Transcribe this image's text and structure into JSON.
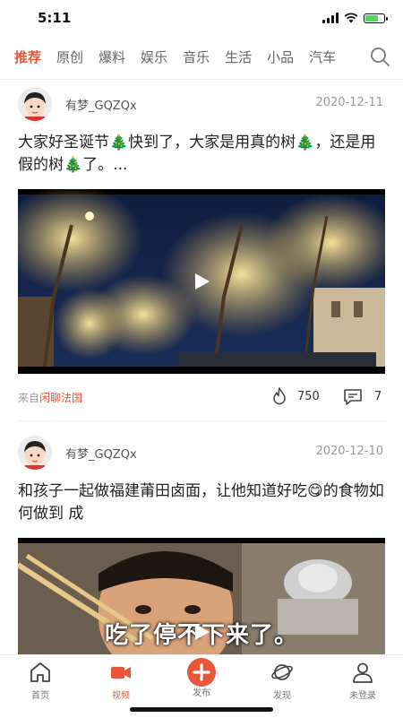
{
  "status_bar": {
    "time": "5:11"
  },
  "tabs": [
    "推荐",
    "原创",
    "爆料",
    "娱乐",
    "音乐",
    "生活",
    "小品",
    "汽车"
  ],
  "active_tab": 0,
  "posts": [
    {
      "username": "有梦_GQZQx",
      "date": "2020-12-11",
      "text_parts": [
        "大家好圣诞节",
        "🎄",
        "快到了，大家是用真的树",
        "🎄",
        "，还是用假的树",
        "🎄",
        "了。..."
      ],
      "source_prefix": "来自",
      "source_name": "闲聊法国",
      "likes": "750",
      "comments": "7"
    },
    {
      "username": "有梦_GQZQx",
      "date": "2020-12-10",
      "text": "和孩子一起做福建莆田卤面，让他知道好吃😋的食物如何做到 成",
      "video_caption": "吃了停不下来了。"
    }
  ],
  "bottom_nav": [
    {
      "label": "首页",
      "icon": "home-icon"
    },
    {
      "label": "视频",
      "icon": "video-camera-icon"
    },
    {
      "label": "发布",
      "icon": "plus-circle-icon"
    },
    {
      "label": "发现",
      "icon": "planet-icon"
    },
    {
      "label": "未登录",
      "icon": "user-icon"
    }
  ],
  "active_nav": 1,
  "colors": {
    "accent": "#e8573a",
    "text": "#222222",
    "muted": "#999999"
  }
}
